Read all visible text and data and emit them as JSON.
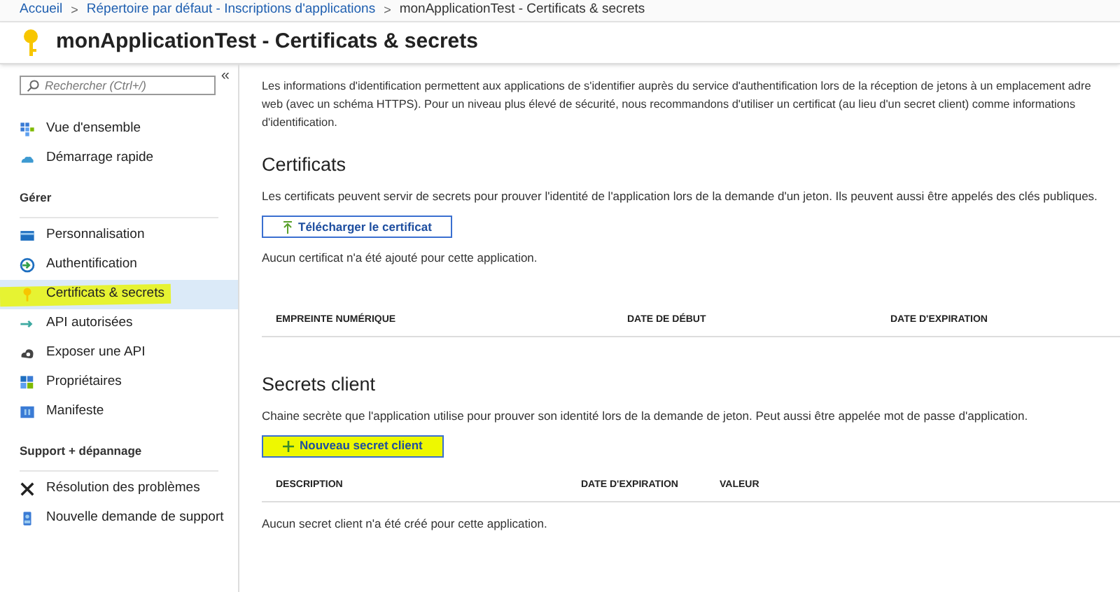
{
  "breadcrumb": [
    {
      "label": "Accueil",
      "kind": "link"
    },
    {
      "label": ">",
      "kind": "separator"
    },
    {
      "label": "Répertoire par défaut - Inscriptions d'applications",
      "kind": "link"
    },
    {
      "label": ">",
      "kind": "separator"
    },
    {
      "label": "monApplicationTest - Certificats & secrets",
      "kind": "current"
    }
  ],
  "page_title": "monApplicationTest - Certificats & secrets",
  "sidebar": {
    "search": {
      "placeholder": "Rechercher (Ctrl+/)"
    },
    "collapse": "«",
    "sections": [
      {
        "items": [
          {
            "label": "Vue d'ensemble",
            "selected": false,
            "highlighted": false
          },
          {
            "label": "Démarrage rapide",
            "selected": false,
            "highlighted": false
          }
        ]
      },
      {
        "heading": "Gérer",
        "items": [
          {
            "label": "Personnalisation",
            "selected": false,
            "highlighted": false
          },
          {
            "label": "Authentification",
            "selected": false,
            "highlighted": false
          },
          {
            "label": "Certificats & secrets",
            "selected": true,
            "highlighted": true
          },
          {
            "label": "API autorisées",
            "selected": false,
            "highlighted": false
          },
          {
            "label": "Exposer une API",
            "selected": false,
            "highlighted": false
          },
          {
            "label": "Propriétaires",
            "selected": false,
            "highlighted": false
          },
          {
            "label": "Manifeste",
            "selected": false,
            "highlighted": false
          }
        ]
      },
      {
        "heading": "Support + dépannage",
        "items": [
          {
            "label": "Résolution des problèmes",
            "selected": false,
            "highlighted": false
          },
          {
            "label": "Nouvelle demande de support",
            "selected": false,
            "highlighted": false
          }
        ]
      }
    ]
  },
  "intro_lines": [
    "Les informations d'identification permettent aux applications de s'identifier auprès du service d'authentification lors de la réception de jetons à un emplacement adre",
    "web (avec un schéma HTTPS). Pour un niveau plus élevé de sécurité, nous recommandons d'utiliser un certificat (au lieu d'un secret client) comme informations",
    "d'identification."
  ],
  "sections": [
    {
      "heading": "Certificats",
      "description": "Les certificats peuvent servir de secrets pour prouver l'identité de l'application lors de la demande d'un jeton. Ils peuvent aussi être appelés des clés publiques.",
      "button": {
        "label": "Télécharger le certificat",
        "highlighted": false
      },
      "empty_message": "Aucun certificat n'a été ajouté pour cette application.",
      "columns": [
        "EMPREINTE NUMÉRIQUE",
        "DATE DE DÉBUT",
        "DATE D'EXPIRATION"
      ]
    },
    {
      "heading": "Secrets client",
      "description": "Chaine secrète que l'application utilise pour prouver son identité lors de la demande de jeton. Peut aussi être appelée mot de passe d'application.",
      "button": {
        "label": "Nouveau secret client",
        "highlighted": true
      },
      "empty_message": "Aucun secret client n'a été créé pour cette application.",
      "columns": [
        "DESCRIPTION",
        "DATE D'EXPIRATION",
        "VALEUR"
      ]
    }
  ]
}
